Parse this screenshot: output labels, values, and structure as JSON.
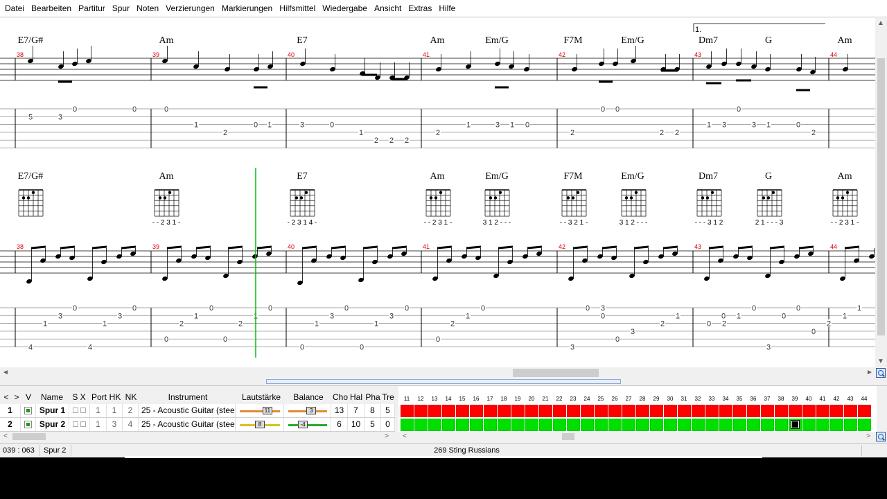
{
  "menu": [
    "Datei",
    "Bearbeiten",
    "Partitur",
    "Spur",
    "Noten",
    "Verzierungen",
    "Markierungen",
    "Hilfsmittel",
    "Wiedergabe",
    "Ansicht",
    "Extras",
    "Hilfe"
  ],
  "score": {
    "volta_label": "1.",
    "system1": {
      "chords": [
        "E7/G#",
        "Am",
        "E7",
        "Am",
        "Em/G",
        "F7M",
        "Em/G",
        "Dm7",
        "G",
        "Am"
      ],
      "measures": [
        "38",
        "39",
        "40",
        "41",
        "42",
        "43",
        "44"
      ]
    },
    "system2": {
      "chords": [
        "E7/G#",
        "Am",
        "E7",
        "Am",
        "Em/G",
        "F7M",
        "Em/G",
        "Dm7",
        "G",
        "Am"
      ],
      "fingerings": [
        "",
        "- - 2 3 1 -",
        "- 2 3 1 4 -",
        "- - 2 3 1 -",
        "3 1 2 - - -",
        "- - 3 2 1 -",
        "3 1 2 - - -",
        "- - - 3 1 2",
        "2 1 - - - 3",
        "- - 2 3 1 -"
      ],
      "measures": [
        "38",
        "39",
        "40",
        "41",
        "42",
        "43",
        "44"
      ]
    },
    "tab1": [
      {
        "s": 2,
        "v": "5"
      },
      {
        "s": 2,
        "v": "3"
      },
      {
        "s": 1,
        "v": "0"
      },
      {
        "s": 1,
        "v": "0"
      },
      {
        "s": 1,
        "v": "0"
      },
      {
        "s": 3,
        "v": "1"
      },
      {
        "s": 4,
        "v": "2"
      },
      {
        "s": 3,
        "v": "0"
      },
      {
        "s": 3,
        "v": "1"
      },
      {
        "s": 3,
        "v": "3"
      },
      {
        "s": 3,
        "v": "0"
      },
      {
        "s": 4,
        "v": "1"
      },
      {
        "s": 5,
        "v": "2"
      },
      {
        "s": 5,
        "v": "2"
      },
      {
        "s": 5,
        "v": "2"
      },
      {
        "s": 4,
        "v": "2"
      },
      {
        "s": 3,
        "v": "1"
      },
      {
        "s": 3,
        "v": "3"
      },
      {
        "s": 3,
        "v": "1"
      },
      {
        "s": 3,
        "v": "0"
      },
      {
        "s": 4,
        "v": "2"
      },
      {
        "s": 1,
        "v": "0"
      },
      {
        "s": 1,
        "v": "0"
      },
      {
        "s": 4,
        "v": "2"
      },
      {
        "s": 4,
        "v": "2"
      },
      {
        "s": 3,
        "v": "1"
      },
      {
        "s": 3,
        "v": "3"
      },
      {
        "s": 1,
        "v": "0"
      },
      {
        "s": 3,
        "v": "3"
      },
      {
        "s": 3,
        "v": "1"
      },
      {
        "s": 3,
        "v": "0"
      },
      {
        "s": 4,
        "v": "2"
      }
    ],
    "tab2": [
      {
        "s": 6,
        "v": "4"
      },
      {
        "s": 3,
        "v": "1"
      },
      {
        "s": 2,
        "v": "3"
      },
      {
        "s": 1,
        "v": "0"
      },
      {
        "s": 6,
        "v": "4"
      },
      {
        "s": 3,
        "v": "1"
      },
      {
        "s": 2,
        "v": "3"
      },
      {
        "s": 1,
        "v": "0"
      },
      {
        "s": 5,
        "v": "0"
      },
      {
        "s": 3,
        "v": "2"
      },
      {
        "s": 2,
        "v": "1"
      },
      {
        "s": 1,
        "v": "0"
      },
      {
        "s": 5,
        "v": "0"
      },
      {
        "s": 3,
        "v": "2"
      },
      {
        "s": 2,
        "v": "1"
      },
      {
        "s": 1,
        "v": "0"
      },
      {
        "s": 6,
        "v": "0"
      },
      {
        "s": 3,
        "v": "1"
      },
      {
        "s": 2,
        "v": "3"
      },
      {
        "s": 1,
        "v": "0"
      },
      {
        "s": 6,
        "v": "0"
      },
      {
        "s": 3,
        "v": "1"
      },
      {
        "s": 2,
        "v": "3"
      },
      {
        "s": 1,
        "v": "0"
      },
      {
        "s": 5,
        "v": "0"
      },
      {
        "s": 3,
        "v": "2"
      },
      {
        "s": 2,
        "v": "1"
      },
      {
        "s": 1,
        "v": "0"
      },
      {
        "s": 6,
        "v": "3"
      },
      {
        "s": 1,
        "v": "0"
      },
      {
        "s": 2,
        "v": "0"
      },
      {
        "s": 4,
        "v": "3"
      },
      {
        "s": 3,
        "v": "2"
      },
      {
        "s": 2,
        "v": "1"
      },
      {
        "s": 1,
        "v": "0"
      },
      {
        "s": 6,
        "v": "3"
      },
      {
        "s": 2,
        "v": "0"
      },
      {
        "s": 1,
        "v": "0"
      },
      {
        "s": 4,
        "v": "0"
      },
      {
        "s": 3,
        "v": "2"
      },
      {
        "s": 2,
        "v": "1"
      },
      {
        "s": 1,
        "v": "1"
      },
      {
        "s": 6,
        "v": "3"
      },
      {
        "s": 3,
        "v": "0"
      },
      {
        "s": 2,
        "v": "0"
      },
      {
        "s": 1,
        "v": "3"
      },
      {
        "s": 5,
        "v": "0"
      },
      {
        "s": 3,
        "v": "2"
      },
      {
        "s": 2,
        "v": "1"
      }
    ]
  },
  "tracks": {
    "headers": {
      "v": "V",
      "name": "Name",
      "sx": "S X",
      "port": "Port",
      "hk": "HK",
      "nk": "NK",
      "instrument": "Instrument",
      "volume": "Lautstärke",
      "balance": "Balance",
      "cho": "Cho",
      "hal": "Hal",
      "pha": "Pha",
      "tre": "Tre"
    },
    "rows": [
      {
        "num": "1",
        "name": "Spur 1",
        "port": "1",
        "hk": "1",
        "nk": "2",
        "instrument": "25 - Acoustic Guitar (steel)",
        "volume": "11",
        "balance": "3",
        "cho": "13",
        "hal": "7",
        "pha": "8",
        "tre": "5",
        "color": "#ff0000"
      },
      {
        "num": "2",
        "name": "Spur 2",
        "port": "1",
        "hk": "3",
        "nk": "4",
        "instrument": "25 - Acoustic Guitar (steel)",
        "volume": "8",
        "balance": "-4",
        "cho": "6",
        "hal": "10",
        "pha": "5",
        "tre": "0",
        "color": "#00e000"
      }
    ],
    "bar_numbers": [
      "11",
      "12",
      "13",
      "14",
      "15",
      "16",
      "17",
      "18",
      "19",
      "20",
      "21",
      "22",
      "23",
      "24",
      "25",
      "26",
      "27",
      "28",
      "29",
      "30",
      "31",
      "32",
      "33",
      "34",
      "35",
      "36",
      "37",
      "38",
      "39",
      "40",
      "41",
      "42",
      "43",
      "44"
    ],
    "current_bar": "39"
  },
  "status": {
    "position": "039 : 063",
    "track": "Spur 2",
    "title": "269  Sting  Russians"
  },
  "icons": {
    "scroll_left": "◄",
    "scroll_right": "►",
    "scroll_up": "▲",
    "scroll_down": "▼",
    "nav_prev": "<",
    "nav_next": ">"
  }
}
